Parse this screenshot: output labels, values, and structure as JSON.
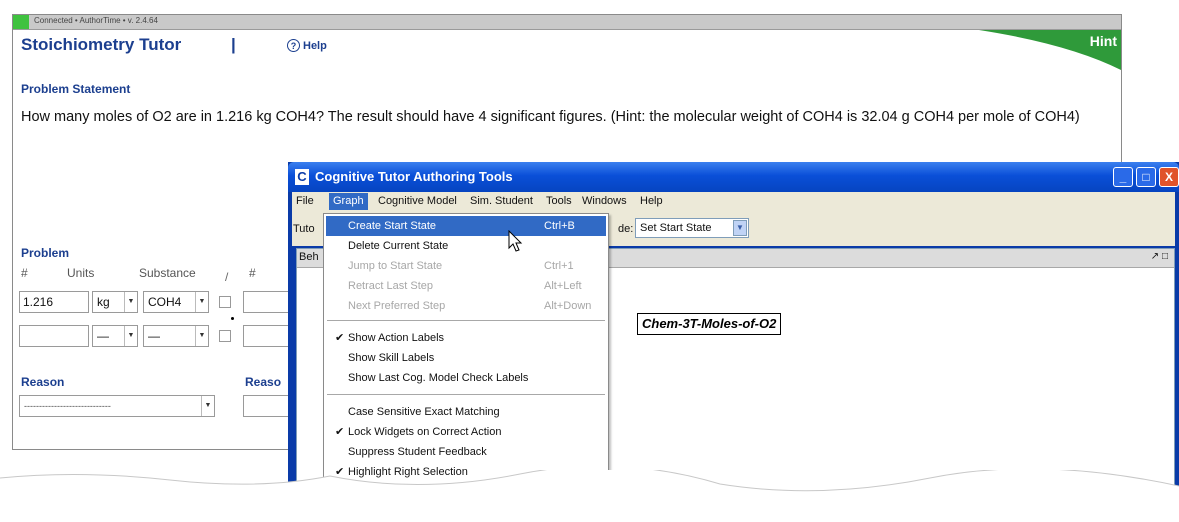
{
  "tutor": {
    "status_text": "Connected • AuthorTime • v. 2.4.64",
    "title": "Stoichiometry Tutor",
    "title_separator": "|",
    "help_icon": "?",
    "help_label": "Help",
    "hint_label": "Hint",
    "problem_statement_heading": "Problem Statement",
    "problem_statement_text": "How many moles of O2 are in 1.216 kg COH4? The result should have 4 significant figures. (Hint: the molecular weight of COH4 is 32.04 g COH4 per mole of COH4)",
    "problem_heading": "Problem",
    "col_number": "#",
    "col_units": "Units",
    "col_substance": "Substance",
    "col_number2": "#",
    "slash": "/",
    "row1": {
      "number": "1.216",
      "units": "kg",
      "substance": "COH4"
    },
    "row2": {
      "number": "",
      "units": "—",
      "substance": "—"
    },
    "reason_label": "Reason",
    "reason_label_2": "Reaso",
    "reason_select": "-----------------------------"
  },
  "ctat": {
    "app_icon": "C",
    "title": "Cognitive Tutor Authoring Tools",
    "window_buttons": {
      "minimize": "_",
      "maximize": "□",
      "close": "X"
    },
    "menu": [
      "File",
      "Graph",
      "Cognitive Model",
      "Sim. Student",
      "Tools",
      "Windows",
      "Help"
    ],
    "toolbar": {
      "tutor_label": "Tuto",
      "mode_label": "de:",
      "mode_value": "Set Start State"
    },
    "panel_title": "Beh",
    "panel_controls": "↗ □",
    "state_node": "Chem-3T-Moles-of-O2"
  },
  "graph_menu": {
    "items": [
      {
        "label": "Create Start State",
        "shortcut": "Ctrl+B",
        "highlighted": true
      },
      {
        "label": "Delete Current State",
        "shortcut": ""
      },
      {
        "label": "Jump to Start State",
        "shortcut": "Ctrl+1",
        "disabled": true
      },
      {
        "label": "Retract Last Step",
        "shortcut": "Alt+Left",
        "disabled": true
      },
      {
        "label": "Next Preferred Step",
        "shortcut": "Alt+Down",
        "disabled": true
      },
      {
        "label": "Show Action Labels",
        "checked": true
      },
      {
        "label": "Show Skill Labels"
      },
      {
        "label": "Show Last Cog. Model Check Labels"
      },
      {
        "label": "Case Sensitive Exact Matching"
      },
      {
        "label": "Lock Widgets on Correct Action",
        "checked": true
      },
      {
        "label": "Suppress Student Feedback"
      },
      {
        "label": "Highlight Right Selection",
        "checked": true
      }
    ],
    "check_mark": "✔"
  },
  "colors": {
    "tutor_blue": "#1c3f8f",
    "hint_green": "#2f9a3a",
    "xp_blue": "#0a4fd8",
    "menu_highlight": "#316ac5"
  }
}
